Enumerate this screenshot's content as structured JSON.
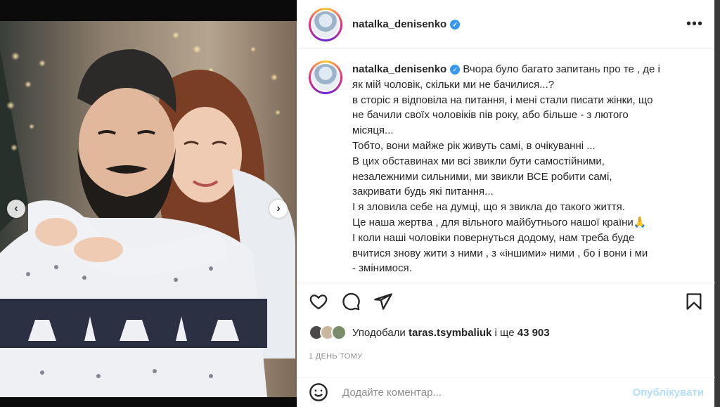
{
  "post": {
    "username": "natalka_denisenko",
    "verified_icon": "verified-badge-icon",
    "more_options": "•••"
  },
  "caption": {
    "username": "natalka_denisenko",
    "lines": [
      "Вчора було багато запитань про те , де і",
      "як мій чоловік, скільки ми не бачилися...?",
      "в сторіс я відповіла на питання, і мені стали писати жінки, що",
      "не бачили своїх чоловіків пів року, або більше - з лютого",
      "місяця...",
      "Тобто, вони майже рік живуть самі, в очікуванні ...",
      "В цих обставинах ми всі звикли бути самостійними,",
      "незалежними сильними, ми звикли ВСЕ робити самі,",
      "закривати будь які питання...",
      "І я зловила себе на думці, що я звикла до такого життя.",
      "Це наша жертва , для вільного майбутнього нашої країни🙏",
      "І коли наші чоловіки повернуться додому, нам треба буде",
      "вчитися знову жити з ними , з «іншими» ними , бо і вони і ми",
      "- змінимося."
    ]
  },
  "actions": {
    "like_icon": "heart-icon",
    "comment_icon": "comment-icon",
    "share_icon": "share-icon",
    "save_icon": "bookmark-icon"
  },
  "likes": {
    "prefix": "Уподобали",
    "user": "taras.tsymbaliuk",
    "middle": "і ще",
    "count": "43 903"
  },
  "timestamp": "1 ДЕНЬ ТОМУ",
  "comment": {
    "placeholder": "Додайте коментар...",
    "publish_label": "Опублікувати"
  },
  "colors": {
    "accent": "#3897f0",
    "publish_disabled": "#b2dffc",
    "text": "#262626",
    "muted": "#8e8e8e"
  }
}
